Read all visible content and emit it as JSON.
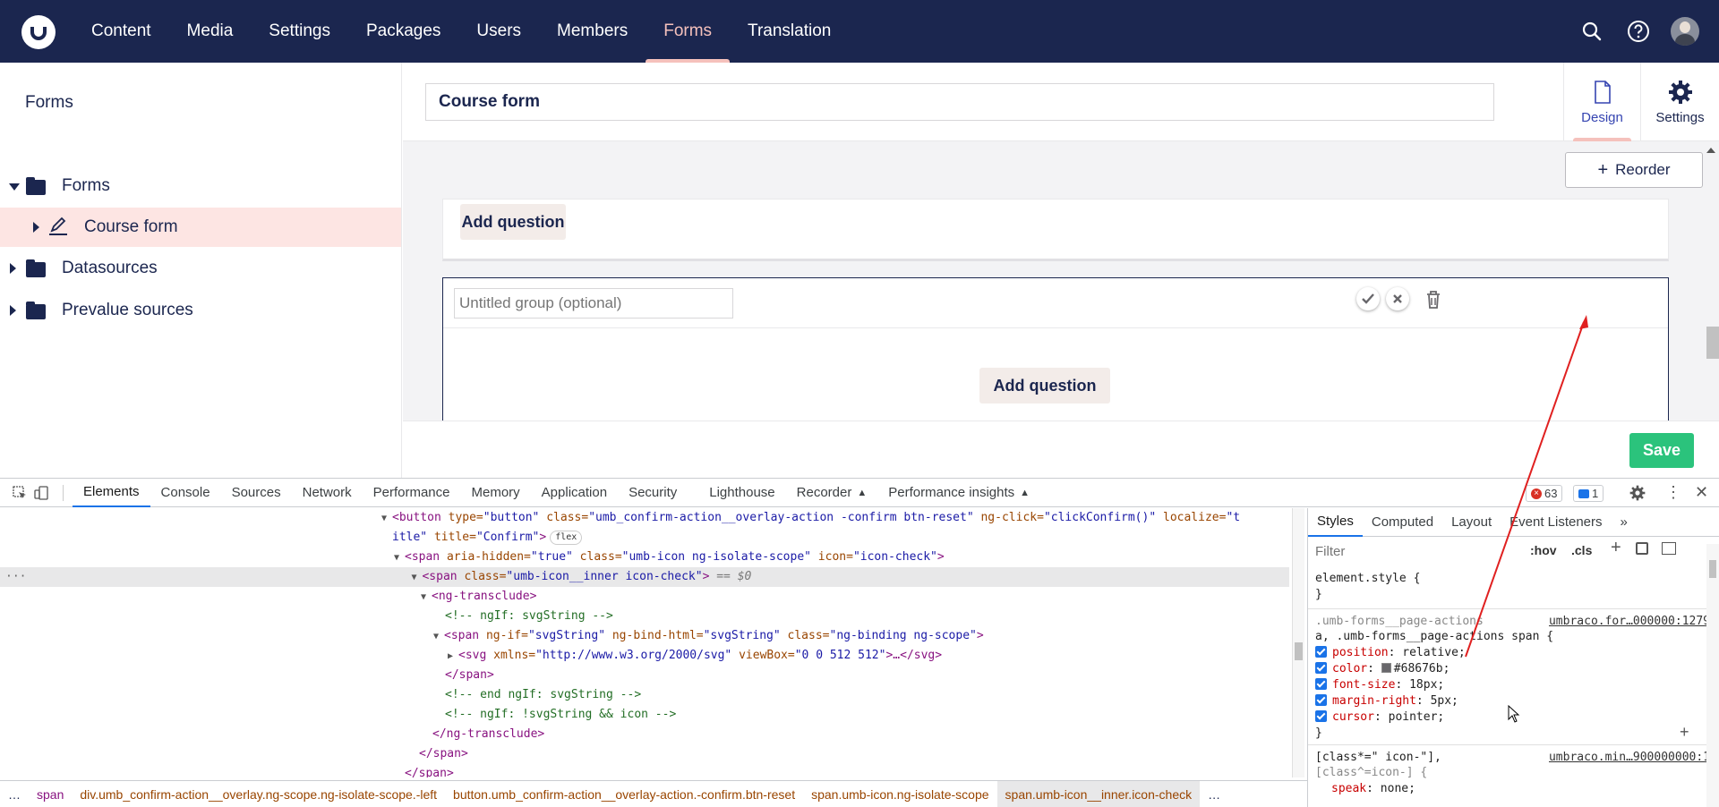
{
  "nav": {
    "items": [
      {
        "label": "Content"
      },
      {
        "label": "Media"
      },
      {
        "label": "Settings"
      },
      {
        "label": "Packages"
      },
      {
        "label": "Users"
      },
      {
        "label": "Members"
      },
      {
        "label": "Forms"
      },
      {
        "label": "Translation"
      }
    ],
    "active": "Forms",
    "icons": [
      "search-icon",
      "help-icon",
      "user-avatar"
    ]
  },
  "sidebar": {
    "title": "Forms",
    "tree": [
      {
        "label": "Forms",
        "expanded": true
      },
      {
        "label": "Course form",
        "selected": true
      },
      {
        "label": "Datasources"
      },
      {
        "label": "Prevalue sources"
      }
    ]
  },
  "editor": {
    "form_name": "Course form",
    "tabs": [
      {
        "label": "Design"
      },
      {
        "label": "Settings"
      }
    ],
    "reorder_label": "Reorder",
    "add_question_label": "Add question",
    "group_placeholder": "Untitled group (optional)",
    "save_label": "Save"
  },
  "devtools": {
    "tabs": [
      "Elements",
      "Console",
      "Sources",
      "Network",
      "Performance",
      "Memory",
      "Application",
      "Security",
      "Lighthouse",
      "Recorder",
      "Performance insights"
    ],
    "errors": "63",
    "messages": "1",
    "elements": {
      "l1_tag": "<button",
      "l1_a1": " type=",
      "l1_v1": "\"button\"",
      "l1_a2": " class=",
      "l1_v2": "\"umb_confirm-action__overlay-action -confirm btn-reset\"",
      "l1_a3": " ng-click=",
      "l1_v3": "\"clickConfirm()\"",
      "l1_a4": " localize=",
      "l1_v4": "\"t",
      "l2_v": "itle\"",
      "l2_a": " title=",
      "l2_v2": "\"Confirm\"",
      "l2_tag": ">",
      "l2_pill": "flex",
      "l3_tag": "<span",
      "l3_a1": " aria-hidden=",
      "l3_v1": "\"true\"",
      "l3_a2": " class=",
      "l3_v2": "\"umb-icon ng-isolate-scope\"",
      "l3_a3": " icon=",
      "l3_v3": "\"icon-check\"",
      "l3_end": ">",
      "l4_tag": "<span",
      "l4_a": " class=",
      "l4_v": "\"umb-icon__inner icon-check\"",
      "l4_end": ">",
      "l4_eq": " == $0",
      "l5": "<ng-transclude>",
      "l6": "<!-- ngIf: svgString -->",
      "l7_tag": "<span",
      "l7_a1": " ng-if=",
      "l7_v1": "\"svgString\"",
      "l7_a2": " ng-bind-html=",
      "l7_v2": "\"svgString\"",
      "l7_a3": " class=",
      "l7_v3": "\"ng-binding ng-scope\"",
      "l7_end": ">",
      "l8_tag": "<svg",
      "l8_a1": " xmlns=",
      "l8_v1": "\"http://www.w3.org/2000/svg\"",
      "l8_a2": " viewBox=",
      "l8_v2": "\"0 0 512 512\"",
      "l8_end": ">…</svg>",
      "l9": "</span>",
      "l10": "<!-- end ngIf: svgString -->",
      "l11": "<!-- ngIf: !svgString && icon -->",
      "l12": "</ng-transclude>",
      "l13": "</span>",
      "l14": "</span>"
    },
    "styles": {
      "tabs": [
        "Styles",
        "Computed",
        "Layout",
        "Event Listeners"
      ],
      "filter_placeholder": "Filter",
      "hov": ":hov",
      "cls": ".cls",
      "element_style": "element.style {",
      "close_brace": "}",
      "rule1_sel1": ".umb-forms__page-actions",
      "rule1_sel2": "a, .umb-forms__page-actions span {",
      "rule1_src": "umbraco.for…000000:1279",
      "props": [
        {
          "name": "position",
          "value": "relative;"
        },
        {
          "name": "color",
          "value": "#68676b;"
        },
        {
          "name": "font-size",
          "value": "18px;"
        },
        {
          "name": "margin-right",
          "value": "5px;"
        },
        {
          "name": "cursor",
          "value": "pointer;"
        }
      ],
      "rule2_sel1": "[class*=\" icon-\"],",
      "rule2_sel2": "[class^=icon-] {",
      "rule2_src": "umbraco.min…900000000:1",
      "rule2_prop": "speak",
      "rule2_val": "none;"
    },
    "breadcrumbs": [
      "…",
      "span",
      "div.umb_confirm-action__overlay.ng-scope.ng-isolate-scope.-left",
      "button.umb_confirm-action__overlay-action.-confirm.btn-reset",
      "span.umb-icon.ng-isolate-scope",
      "span.umb-icon__inner.icon-check",
      "…"
    ]
  },
  "colors": {
    "header_bg": "#1b264f",
    "accent": "#f5c1bc",
    "save": "#2bc37c",
    "selected_row": "#fde5e3"
  }
}
